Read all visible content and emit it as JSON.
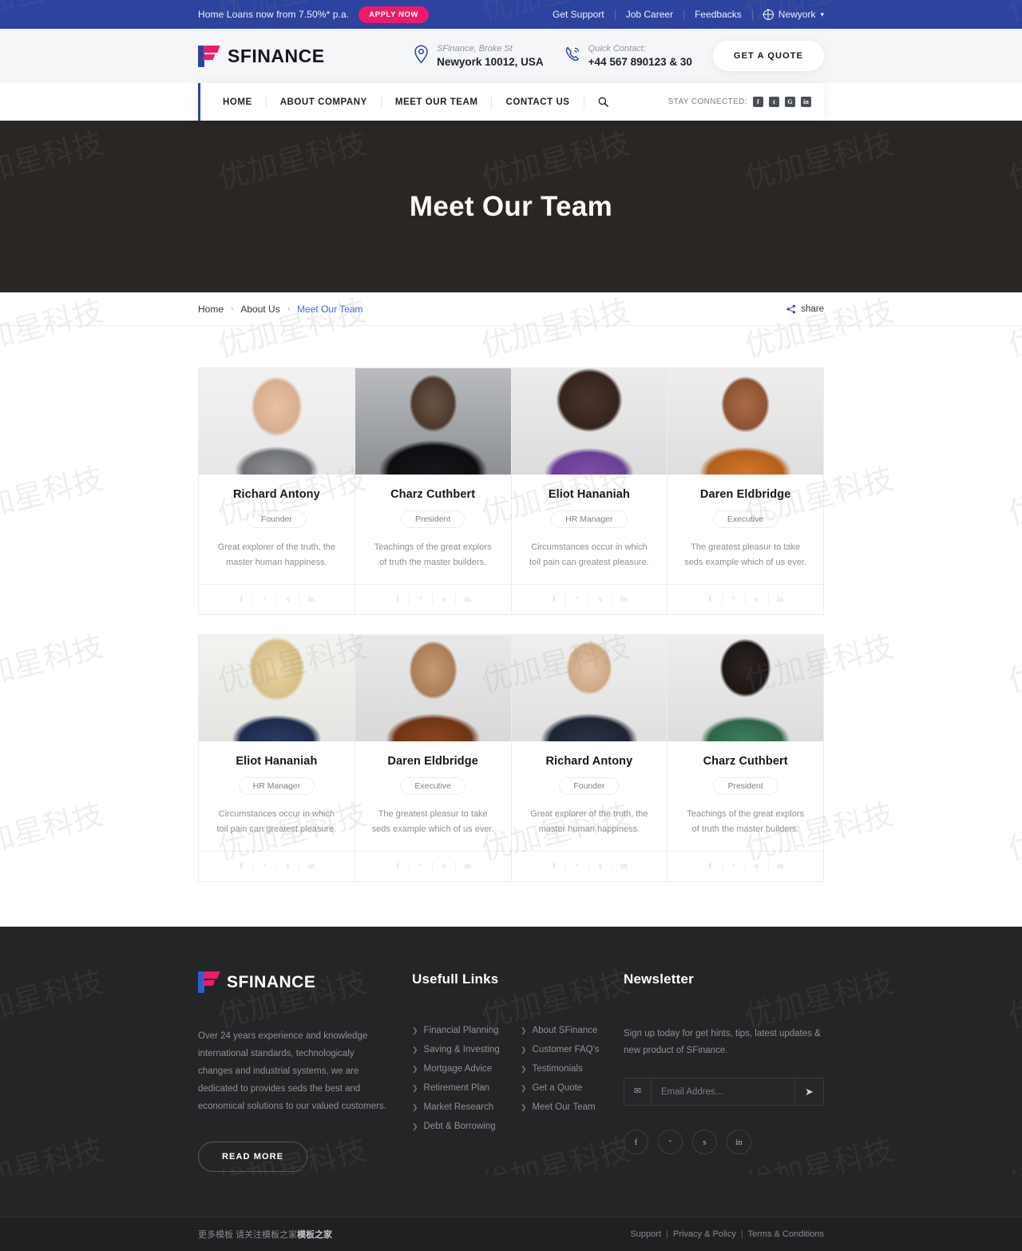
{
  "topbar": {
    "promo": "Home Loans now from 7.50%* p.a.",
    "apply_label": "APPLY NOW",
    "links": [
      "Get Support",
      "Job Career",
      "Feedbacks"
    ],
    "language": "Newyork",
    "globe_icon": "globe-icon",
    "caret_icon": "chevron-down-icon",
    "accent_color": "#2c43a0",
    "apply_color": "#ee1b6b"
  },
  "header": {
    "brand": "SFINANCE",
    "address_label": "SFinance, Broke St",
    "address_value": "Newyork 10012, USA",
    "contact_label": "Quick Contact:",
    "contact_value": "+44 567 890123 & 30",
    "quote_label": "GET A QUOTE",
    "pin_icon": "map-pin-icon",
    "phone_icon": "phone-icon"
  },
  "nav": {
    "items": [
      "HOME",
      "ABOUT COMPANY",
      "MEET OUR TEAM",
      "CONTACT US"
    ],
    "search_icon": "search-icon",
    "stay_label": "STAY CONNECTED:",
    "socials": [
      {
        "name": "facebook-icon",
        "glyph": "f"
      },
      {
        "name": "twitter-icon",
        "glyph": "t"
      },
      {
        "name": "google-plus-icon",
        "glyph": "G"
      },
      {
        "name": "linkedin-icon",
        "glyph": "in"
      }
    ]
  },
  "hero": {
    "title": "Meet Our Team"
  },
  "breadcrumb": {
    "items": [
      "Home",
      "About Us"
    ],
    "current": "Meet Our Team",
    "separator": "›",
    "share_label": "share",
    "share_icon": "share-icon"
  },
  "team": {
    "social_icons": [
      {
        "name": "facebook-icon",
        "glyph": "f"
      },
      {
        "name": "twitter-icon",
        "glyph": "ᵛ"
      },
      {
        "name": "skype-icon",
        "glyph": "s"
      },
      {
        "name": "linkedin-icon",
        "glyph": "in"
      }
    ],
    "rows": [
      [
        {
          "name": "Richard Antony",
          "role": "Founder",
          "desc": "Great explorer of the truth, the master human happiness.",
          "photo": "portrait-smiling-man-grey-blazer"
        },
        {
          "name": "Charz Cuthbert",
          "role": "President",
          "desc": "Teachings of the great explors of truth the master builders.",
          "photo": "portrait-man-glasses-dark-suit"
        },
        {
          "name": "Eliot Hananiah",
          "role": "HR Manager",
          "desc": "Circumstances occur in which toil pain can greatest pleasure.",
          "photo": "portrait-woman-curly-hair-purple-top"
        },
        {
          "name": "Daren Eldbridge",
          "role": "Executive",
          "desc": "The greatest pleasur to take seds example which of us ever.",
          "photo": "portrait-man-headphones-orange-jacket"
        }
      ],
      [
        {
          "name": "Eliot Hananiah",
          "role": "HR Manager",
          "desc": "Circumstances occur in which toil pain can greatest pleasure.",
          "photo": "portrait-blonde-woman-polka-dot-blouse"
        },
        {
          "name": "Daren Eldbridge",
          "role": "Executive",
          "desc": "The greatest pleasur to take seds example which of us ever.",
          "photo": "portrait-man-brown-shirt-beard"
        },
        {
          "name": "Richard Antony",
          "role": "Founder",
          "desc": "Great explorer of the truth, the master human happiness.",
          "photo": "portrait-bald-man-glasses-navy-suit"
        },
        {
          "name": "Charz Cuthbert",
          "role": "President",
          "desc": "Teachings of the great explors of truth the master builders.",
          "photo": "portrait-woman-green-top-short-hair"
        }
      ]
    ]
  },
  "footer": {
    "brand": "SFINANCE",
    "description": "Over 24 years experience and knowledge international standards, technologicaly changes and industrial systems, we are dedicated to provides seds the best and economical solutions to our valued customers.",
    "read_more": "READ MORE",
    "links_title": "Usefull Links",
    "links_col1": [
      "Financial Planning",
      "Saving & Investing",
      "Mortgage Advice",
      "Retirement Plan",
      "Market Research",
      "Debt & Borrowing"
    ],
    "links_col2": [
      "About SFinance",
      "Customer FAQ's",
      "Testimonials",
      "Get a Quote",
      "Meet Our Team"
    ],
    "newsletter_title": "Newsletter",
    "newsletter_text": "Sign up today for get hints, tips, latest updates & new product of SFinance.",
    "email_placeholder": "Email Addres...",
    "email_value": "",
    "mail_icon": "mail-icon",
    "send_icon": "send-icon",
    "socials": [
      {
        "name": "facebook-icon",
        "glyph": "f"
      },
      {
        "name": "twitter-icon",
        "glyph": "ᵛ"
      },
      {
        "name": "skype-icon",
        "glyph": "s"
      },
      {
        "name": "linkedin-icon",
        "glyph": "in"
      }
    ]
  },
  "bottombar": {
    "left_text": "更多模板 请关注模板之家",
    "left_bold": "模板之家",
    "right_links": [
      "Support",
      "Privacy & Policy",
      "Terms & Conditions"
    ]
  },
  "watermark": {
    "text": "优加星科技"
  }
}
